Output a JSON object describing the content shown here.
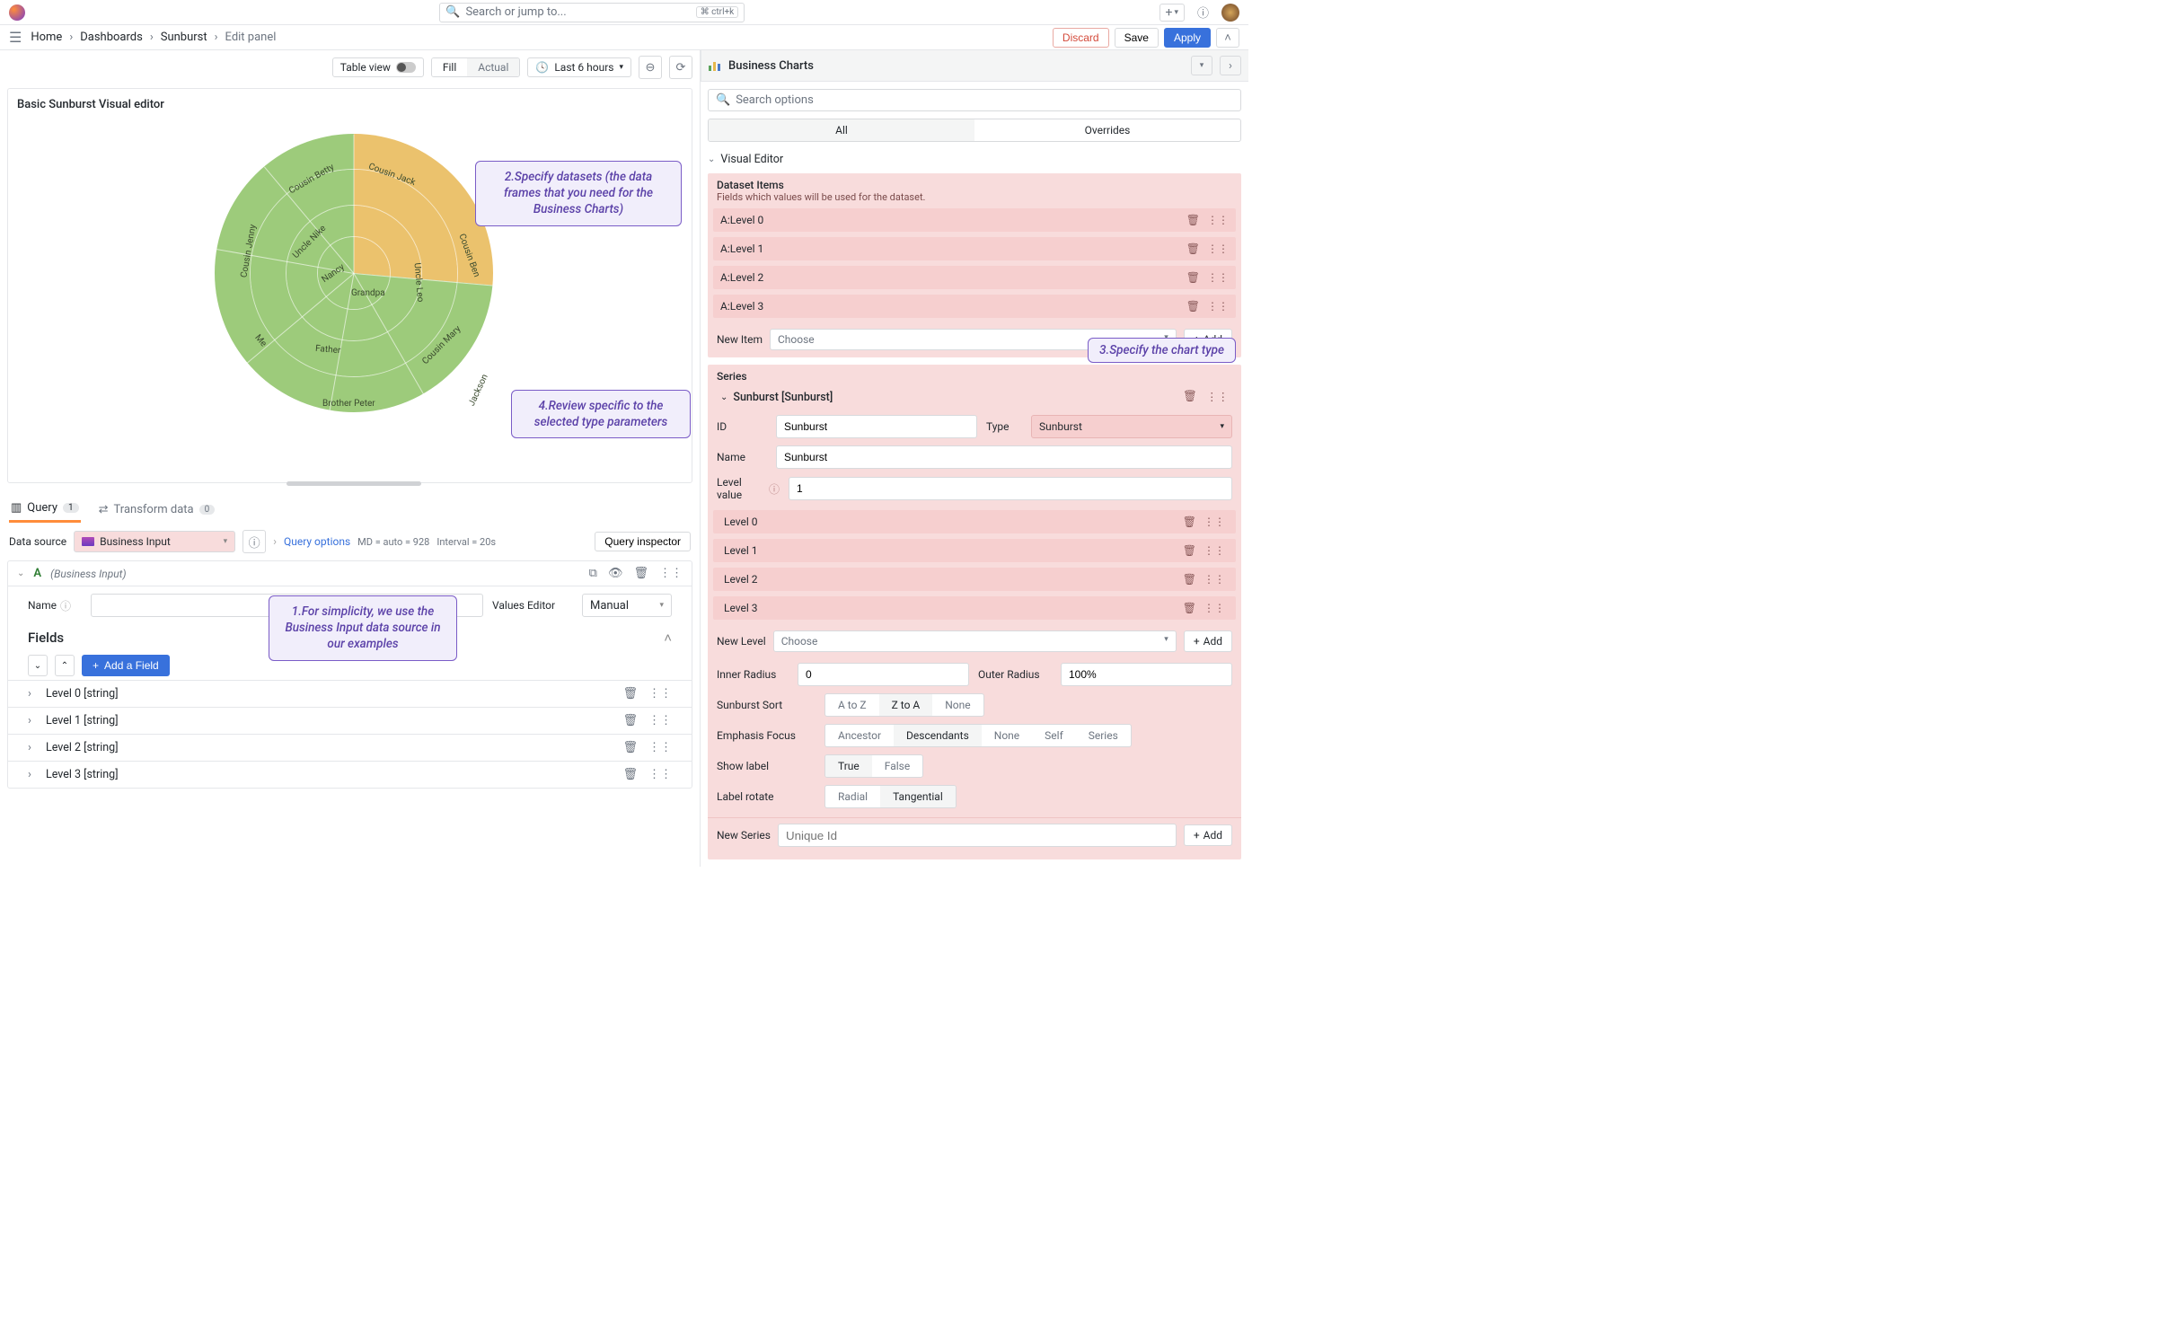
{
  "search": {
    "placeholder": "Search or jump to...",
    "kbd": "⌘ ctrl+k"
  },
  "breadcrumb": [
    "Home",
    "Dashboards",
    "Sunburst",
    "Edit panel"
  ],
  "actions": {
    "discard": "Discard",
    "save": "Save",
    "apply": "Apply"
  },
  "left_toolbar": {
    "table_view": "Table view",
    "fill": "Fill",
    "actual": "Actual",
    "time_range": "Last 6 hours"
  },
  "panel": {
    "title": "Basic Sunburst Visual editor"
  },
  "callouts": {
    "c1": "1.For simplicity, we use the Business Input data source in our examples",
    "c2": "2.Specify datasets (the data frames that you need for the Business Charts)",
    "c3": "3.Specify the chart type",
    "c4": "4.Review specific to the selected type parameters"
  },
  "chart_data": {
    "type": "sunburst",
    "root": "",
    "levels": [
      {
        "name": "Nancy",
        "color": "yellow"
      },
      {
        "name": "Grandpa",
        "color": "green"
      }
    ],
    "labels": [
      "Nancy",
      "Grandpa",
      "Uncle Nike",
      "Uncle Leo",
      "Father",
      "Cousin Betty",
      "Cousin Jenny",
      "Cousin Jack",
      "Cousin Ben",
      "Cousin Mary",
      "Me",
      "Brother Peter",
      "Jackson"
    ]
  },
  "tabs": {
    "query": {
      "label": "Query",
      "count": "1"
    },
    "transform": {
      "label": "Transform data",
      "count": "0"
    }
  },
  "ds": {
    "label": "Data source",
    "name": "Business Input",
    "query_options": "Query options",
    "md": "MD = auto = 928",
    "interval": "Interval = 20s",
    "inspector": "Query inspector"
  },
  "qA": {
    "letter": "A",
    "ds": "(Business Input)",
    "name_label": "Name",
    "values_editor_label": "Values Editor",
    "values_editor_value": "Manual"
  },
  "fields": {
    "heading": "Fields",
    "add": "Add a Field",
    "rows": [
      "Level 0 [string]",
      "Level 1 [string]",
      "Level 2 [string]",
      "Level 3 [string]"
    ]
  },
  "right": {
    "title": "Business Charts",
    "search_placeholder": "Search options",
    "tab_all": "All",
    "tab_over": "Overrides",
    "visual_editor": "Visual Editor",
    "dataset_items": "Dataset Items",
    "dataset_sub": "Fields which values will be used for the dataset.",
    "ds_rows": [
      "A:Level 0",
      "A:Level 1",
      "A:Level 2",
      "A:Level 3"
    ],
    "new_item": "New Item",
    "choose": "Choose",
    "add": "Add",
    "series_label": "Series",
    "series_head": "Sunburst [Sunburst]",
    "id_label": "ID",
    "id_val": "Sunburst",
    "name_label": "Name",
    "name_val": "Sunburst",
    "type_label": "Type",
    "type_val": "Sunburst",
    "level_value_label": "Level value",
    "level_value": "1",
    "levels": [
      "Level 0",
      "Level 1",
      "Level 2",
      "Level 3"
    ],
    "new_level": "New Level",
    "inner_radius_label": "Inner Radius",
    "inner_radius": "0",
    "outer_radius_label": "Outer Radius",
    "outer_radius": "100%",
    "sunburst_sort_label": "Sunburst Sort",
    "sort_opts": [
      "A to Z",
      "Z to A",
      "None"
    ],
    "sort_active": "Z to A",
    "emphasis_label": "Emphasis Focus",
    "emph_opts": [
      "Ancestor",
      "Descendants",
      "None",
      "Self",
      "Series"
    ],
    "emph_active": "Descendants",
    "show_label_label": "Show label",
    "show_opts": [
      "True",
      "False"
    ],
    "show_active": "True",
    "label_rotate_label": "Label rotate",
    "rot_opts": [
      "Radial",
      "Tangential"
    ],
    "rot_active": "Tangential",
    "new_series": "New Series",
    "unique_id_ph": "Unique Id"
  }
}
